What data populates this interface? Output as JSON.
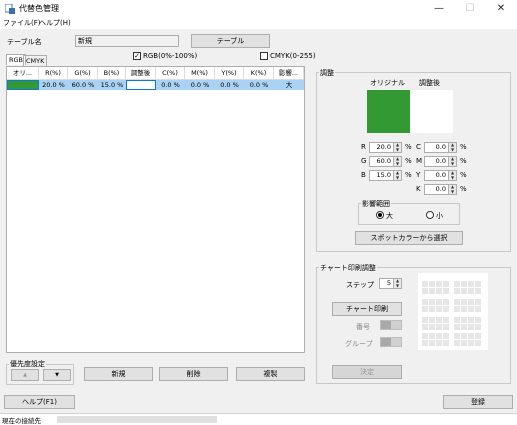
{
  "window": {
    "title": "代替色管理",
    "minimize": "—",
    "maximize": "☐",
    "close": "✕"
  },
  "menu": [
    "ファイル(F)",
    "ヘルプ(H)"
  ],
  "table_name": {
    "label": "テーブル名",
    "value": "新規",
    "button": "テーブル"
  },
  "checkboxes": {
    "rgb": {
      "label": "RGB(0%-100%)",
      "checked": true,
      "mark": "✓"
    },
    "cmyk": {
      "label": "CMYK(0-255)",
      "checked": false,
      "mark": ""
    }
  },
  "tabs": [
    "RGB",
    "CMYK"
  ],
  "table": {
    "headers": [
      "オリ...",
      "R(%)",
      "G(%)",
      "B(%)",
      "調整後",
      "C(%)",
      "M(%)",
      "Y(%)",
      "K(%)",
      "影響..."
    ],
    "rows": [
      {
        "original_color": "#339933",
        "r": "20.0 %",
        "g": "60.0 %",
        "b": "15.0 %",
        "adjusted_color": "#ffffff",
        "c": "0.0 %",
        "m": "0.0 %",
        "y": "0.0 %",
        "k": "0.0 %",
        "influence": "大"
      }
    ]
  },
  "priority": {
    "title": "優先度設定",
    "up": "▲",
    "down": "▼"
  },
  "list_buttons": {
    "new": "新規",
    "delete": "削除",
    "copy": "複製"
  },
  "adjust": {
    "title": "調整",
    "original_label": "オリジナル",
    "adjusted_label": "調整後",
    "original_color": "#339933",
    "adjusted_color": "#ffffff",
    "rgb_fields": [
      {
        "label": "R",
        "value": "20.0",
        "unit": "%"
      },
      {
        "label": "G",
        "value": "60.0",
        "unit": "%"
      },
      {
        "label": "B",
        "value": "15.0",
        "unit": "%"
      }
    ],
    "cmyk_fields": [
      {
        "label": "C",
        "value": "0.0",
        "unit": "%"
      },
      {
        "label": "M",
        "value": "0.0",
        "unit": "%"
      },
      {
        "label": "Y",
        "value": "0.0",
        "unit": "%"
      },
      {
        "label": "K",
        "value": "0.0",
        "unit": "%"
      }
    ],
    "influence": {
      "title": "影響範囲",
      "options": [
        "大",
        "小"
      ],
      "selected": "大"
    },
    "spot_button": "スポットカラーから選択"
  },
  "chart": {
    "title": "チャート印刷調整",
    "step_label": "ステップ",
    "step_value": "5",
    "print_button": "チャート印刷",
    "number_label": "番号",
    "group_label": "グループ",
    "decide_button": "決定"
  },
  "footer": {
    "help": "ヘルプ(F1)",
    "register": "登録",
    "status_label": "現在の接続先"
  }
}
